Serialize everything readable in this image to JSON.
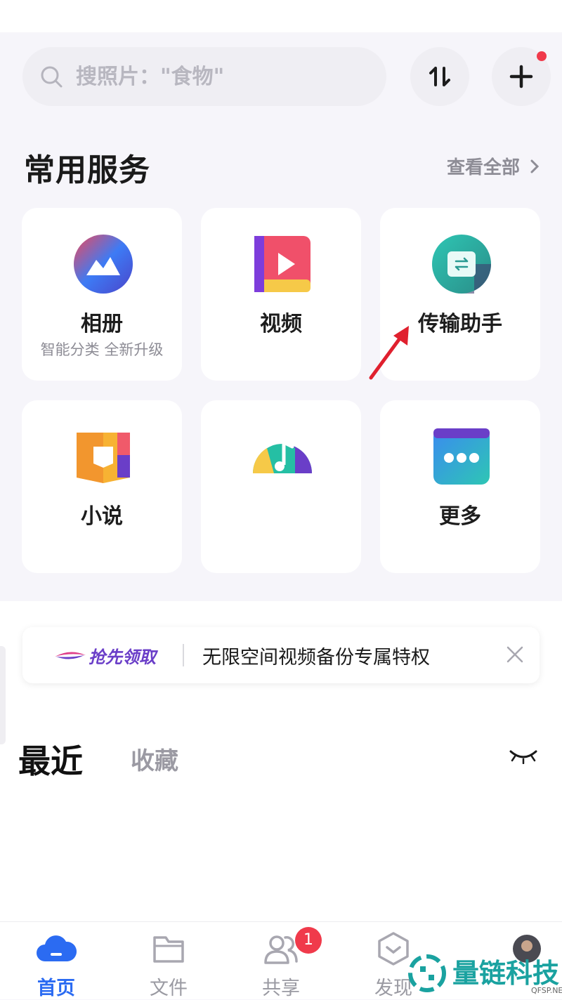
{
  "search": {
    "placeholder": "搜照片：\"食物\""
  },
  "section": {
    "title": "常用服务",
    "view_all": "查看全部"
  },
  "services": [
    {
      "label": "相册",
      "sub": "智能分类 全新升级"
    },
    {
      "label": "视频",
      "sub": ""
    },
    {
      "label": "传输助手",
      "sub": ""
    },
    {
      "label": "小说",
      "sub": ""
    },
    {
      "label": "",
      "sub": ""
    },
    {
      "label": "更多",
      "sub": ""
    }
  ],
  "promo": {
    "claim": "抢先领取",
    "text": "无限空间视频备份专属特权"
  },
  "recent_tabs": {
    "recent": "最近",
    "favorites": "收藏"
  },
  "bottom_nav": {
    "home": "首页",
    "files": "文件",
    "share": "共享",
    "discover": "发现",
    "share_badge": "1"
  },
  "watermark": {
    "brand": "量链科技",
    "site": "QFSP.NET"
  },
  "colors": {
    "accent": "#2b6bf2",
    "badge": "#f03a4b",
    "pointer_arrow": "#e0202e"
  }
}
